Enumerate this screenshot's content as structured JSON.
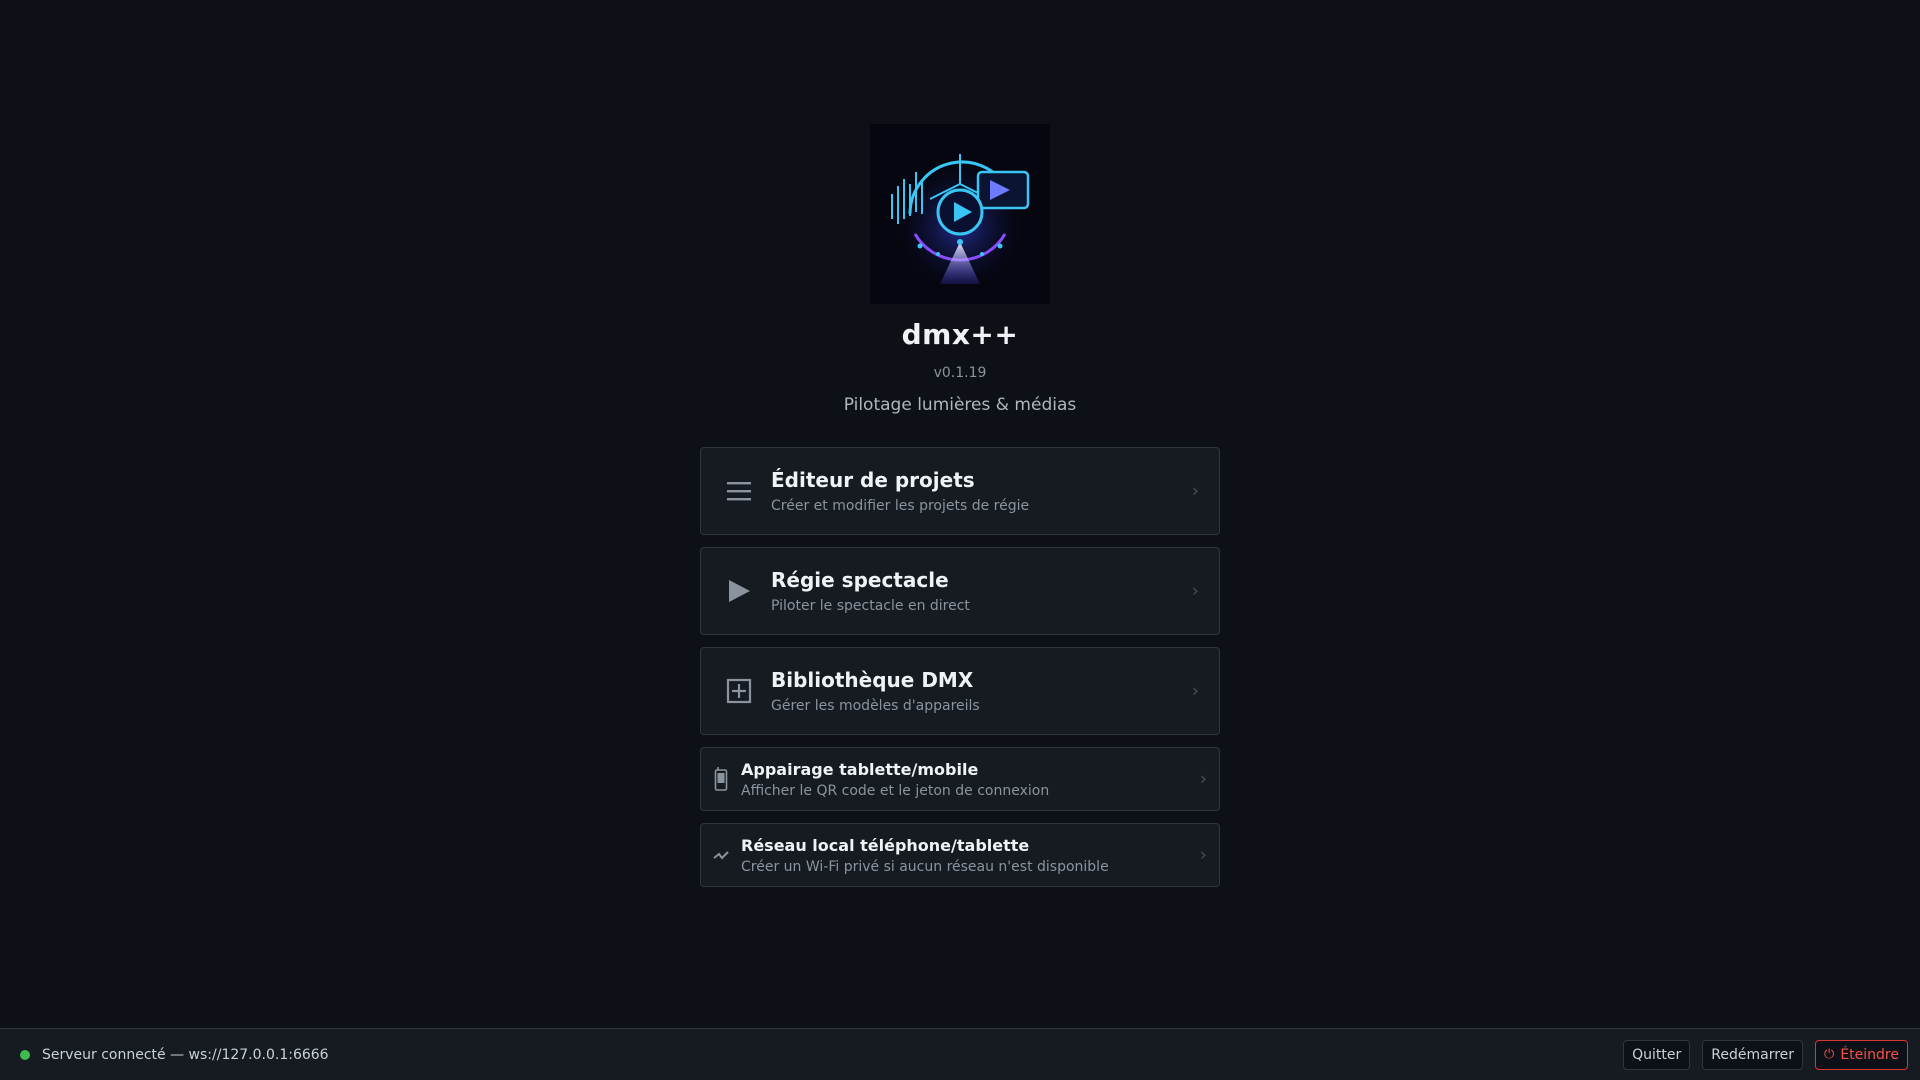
{
  "app": {
    "title": "dmx++",
    "version": "v0.1.19",
    "tagline": "Pilotage lumières & médias"
  },
  "menu": [
    {
      "title": "Éditeur de projets",
      "subtitle": "Créer et modifier les projets de régie",
      "icon": "list-icon"
    },
    {
      "title": "Régie spectacle",
      "subtitle": "Piloter le spectacle en direct",
      "icon": "play-icon"
    },
    {
      "title": "Bibliothèque DMX",
      "subtitle": "Gérer les modèles d'appareils",
      "icon": "grid-box-icon"
    },
    {
      "title": "Appairage tablette/mobile",
      "subtitle": "Afficher le QR code et le jeton de connexion",
      "icon": "mobile-phone-icon"
    },
    {
      "title": "Réseau local téléphone/tablette",
      "subtitle": "Créer un Wi-Fi privé si aucun réseau n'est disponible",
      "icon": "lightning-icon"
    }
  ],
  "status": {
    "text": "Serveur connecté — ws://127.0.0.1:6666",
    "color": "#3fb950"
  },
  "actions": {
    "quit": "Quitter",
    "restart": "Redémarrer",
    "shutdown": "Éteindre"
  },
  "colors": {
    "background": "#0d1117",
    "card": "#161b22",
    "border": "#30363d",
    "danger": "#f85149"
  }
}
